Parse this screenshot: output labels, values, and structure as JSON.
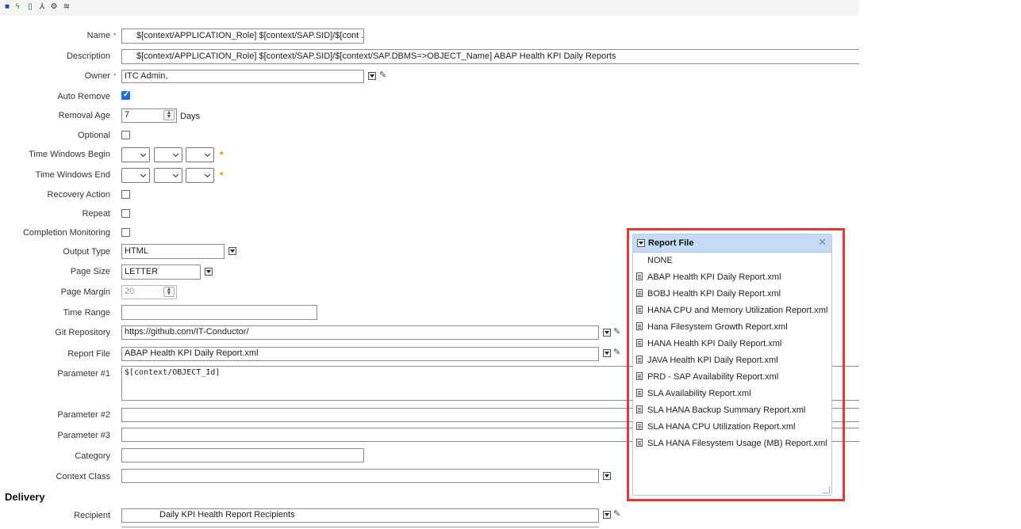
{
  "toolbar": {
    "icons": [
      "save-icon",
      "run-icon",
      "delete-icon",
      "hierarchy-icon",
      "settings-icon",
      "layers-icon"
    ]
  },
  "form": {
    "name": {
      "label": "Name",
      "required": "*",
      "value": "$[context/APPLICATION_Role]  $[context/SAP.SID]/$[cont ..."
    },
    "description": {
      "label": "Description",
      "value": "$[context/APPLICATION_Role]  $[context/SAP.SID]/$[context/SAP.DBMS=>OBJECT_Name]   ABAP Health KPI Daily Reports"
    },
    "owner": {
      "label": "Owner",
      "required": "*",
      "value": "ITC Admin,"
    },
    "auto_remove": {
      "label": "Auto Remove",
      "checked": true
    },
    "removal_age": {
      "label": "Removal Age",
      "value": "7",
      "unit": "Days"
    },
    "optional": {
      "label": "Optional"
    },
    "time_windows_begin": {
      "label": "Time Windows Begin"
    },
    "time_windows_end": {
      "label": "Time Windows End"
    },
    "recovery_action": {
      "label": "Recovery Action"
    },
    "repeat": {
      "label": "Repeat"
    },
    "completion_monitoring": {
      "label": "Completion Monitoring"
    },
    "output_type": {
      "label": "Output Type",
      "value": "HTML"
    },
    "page_size": {
      "label": "Page Size",
      "value": "LETTER"
    },
    "page_margin": {
      "label": "Page Margin",
      "value": "20"
    },
    "time_range": {
      "label": "Time Range",
      "value": ""
    },
    "git_repository": {
      "label": "Git Repository",
      "value": "https://github.com/IT-Conductor/"
    },
    "report_file": {
      "label": "Report File",
      "value": "ABAP Health KPI Daily Report.xml"
    },
    "parameter1": {
      "label": "Parameter #1",
      "value": "$[context/OBJECT_Id]"
    },
    "parameter2": {
      "label": "Parameter #2",
      "value": ""
    },
    "parameter3": {
      "label": "Parameter #3",
      "value": ""
    },
    "category": {
      "label": "Category",
      "value": ""
    },
    "context_class": {
      "label": "Context Class",
      "value": ""
    }
  },
  "delivery": {
    "heading": "Delivery",
    "recipient": {
      "label": "Recipient",
      "value": "Daily KPI Health Report Recipients"
    }
  },
  "popup": {
    "title": "Report File",
    "items": [
      "NONE",
      "ABAP Health KPI Daily Report.xml",
      "BOBJ Health KPI Daily Report.xml",
      "HANA CPU and Memory Utilization Report.xml",
      "Hana Filesystem Growth Report.xml",
      "HANA Health KPI Daily Report.xml",
      "JAVA Health KPI Daily Report.xml",
      "PRD - SAP Availability Report.xml",
      "SLA Availability Report.xml",
      "SLA HANA Backup Summary Report.xml",
      "SLA HANA CPU Utilization Report.xml",
      "SLA HANA Filesystem Usage (MB) Report.xml"
    ]
  },
  "colors": {
    "highlight": "#e23838",
    "popup_header": "#c4dbf5",
    "checkbox_on": "#1e6fd9"
  }
}
